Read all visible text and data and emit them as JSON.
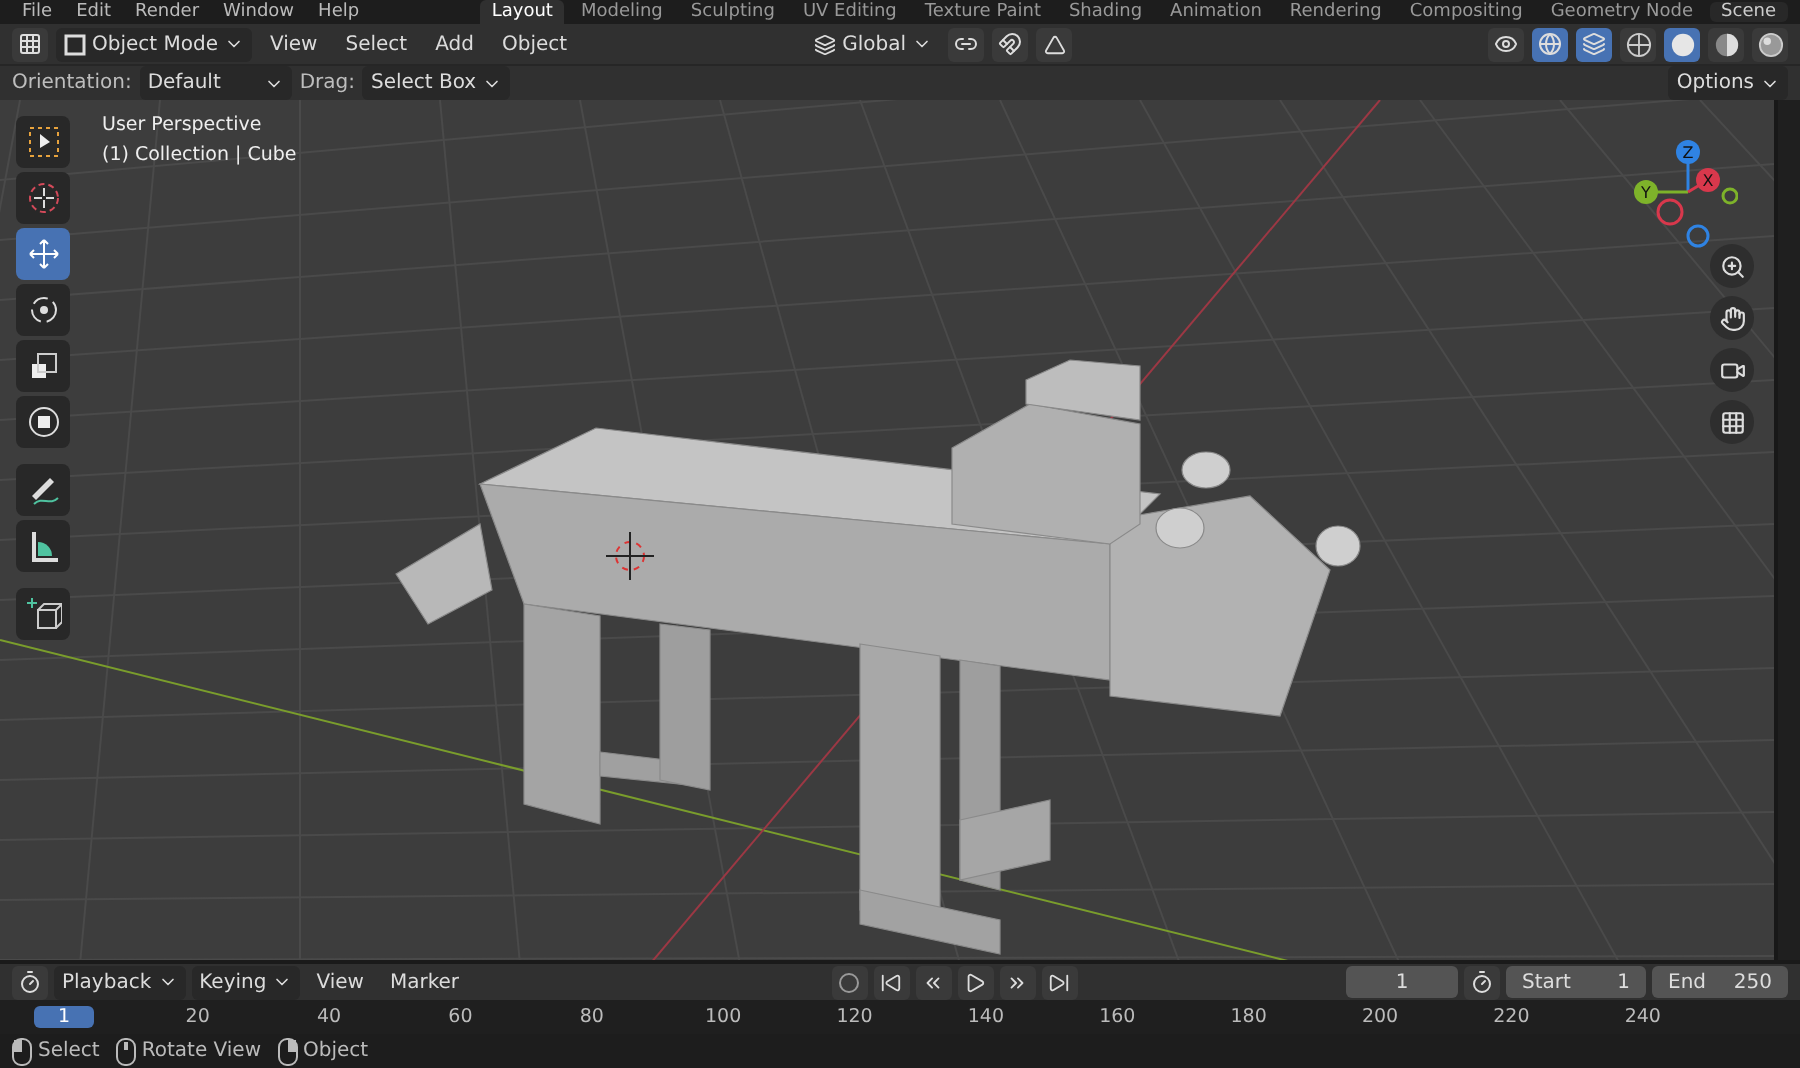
{
  "top_bar": {
    "menus": [
      "File",
      "Edit",
      "Render",
      "Window",
      "Help"
    ],
    "workspaces": [
      {
        "label": "Layout",
        "selected": true
      },
      {
        "label": "Modeling",
        "selected": false
      },
      {
        "label": "Sculpting",
        "selected": false
      },
      {
        "label": "UV Editing",
        "selected": false
      },
      {
        "label": "Texture Paint",
        "selected": false
      },
      {
        "label": "Shading",
        "selected": false
      },
      {
        "label": "Animation",
        "selected": false
      },
      {
        "label": "Rendering",
        "selected": false
      },
      {
        "label": "Compositing",
        "selected": false
      },
      {
        "label": "Geometry Node",
        "selected": false
      }
    ],
    "scene": "Scene"
  },
  "header": {
    "mode": "Object Mode",
    "menus": [
      "View",
      "Select",
      "Add",
      "Object"
    ],
    "orientation": "Global",
    "shading_modes": [
      {
        "kind": "wireframe",
        "selected": false
      },
      {
        "kind": "solid",
        "selected": true
      },
      {
        "kind": "material",
        "selected": false
      },
      {
        "kind": "rendered",
        "selected": false
      }
    ]
  },
  "tool_settings": {
    "orientation_label": "Orientation:",
    "orientation": "Default",
    "drag_label": "Drag:",
    "drag": "Select Box",
    "options": "Options"
  },
  "viewport": {
    "title": "User Perspective",
    "subtitle": "(1) Collection | Cube",
    "axes": [
      "Z",
      "Y",
      "X"
    ]
  },
  "tools": [
    {
      "kind": "select",
      "selected": false
    },
    {
      "kind": "cursor",
      "selected": false
    },
    {
      "kind": "move",
      "selected": true
    },
    {
      "kind": "rotate",
      "selected": false
    },
    {
      "kind": "scale",
      "selected": false
    },
    {
      "kind": "transform",
      "selected": false
    },
    {
      "kind": "annotate",
      "selected": false
    },
    {
      "kind": "measure",
      "selected": false
    },
    {
      "kind": "add-cube",
      "selected": false
    }
  ],
  "timeline": {
    "menus": [
      "Playback",
      "Keying",
      "View",
      "Marker"
    ],
    "current_frame": "1",
    "start_label": "Start",
    "start": "1",
    "end_label": "End",
    "end": "250",
    "cursor": "1",
    "ruler": [
      "20",
      "40",
      "60",
      "80",
      "100",
      "120",
      "140",
      "160",
      "180",
      "200",
      "220",
      "240"
    ]
  },
  "status_bar": [
    {
      "kind": "left",
      "label": "Select"
    },
    {
      "kind": "middle",
      "label": "Rotate View"
    },
    {
      "kind": "right",
      "label": "Object"
    }
  ]
}
